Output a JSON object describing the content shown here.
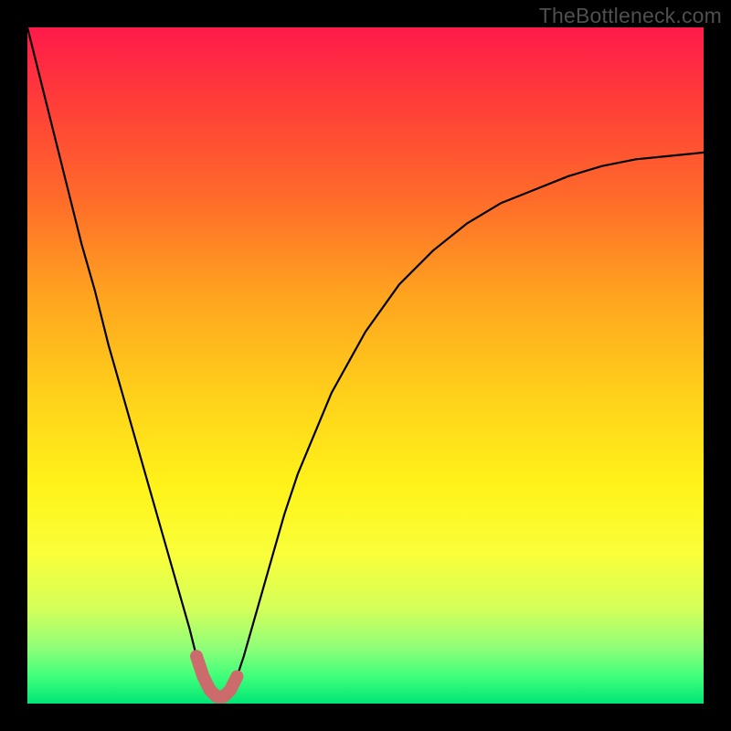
{
  "watermark": "TheBottleneck.com",
  "chart_data": {
    "type": "line",
    "title": "",
    "xlabel": "",
    "ylabel": "",
    "xlim": [
      0,
      100
    ],
    "ylim": [
      0,
      100
    ],
    "grid": false,
    "legend": null,
    "series": [
      {
        "name": "bottleneck-curve",
        "color": "#000000",
        "x": [
          0,
          2,
          4,
          6,
          8,
          10,
          12,
          14,
          16,
          18,
          20,
          22,
          24,
          25,
          26,
          27,
          28,
          29,
          30,
          31,
          32,
          34,
          36,
          38,
          40,
          45,
          50,
          55,
          60,
          65,
          70,
          75,
          80,
          85,
          90,
          95,
          100
        ],
        "y": [
          100,
          92,
          84,
          76,
          68,
          61,
          53,
          46,
          39,
          32,
          25,
          18,
          11,
          7,
          4,
          2,
          1,
          1,
          2,
          4,
          7,
          14,
          21,
          28,
          34,
          46,
          55,
          62,
          67,
          71,
          74,
          76,
          78,
          79.5,
          80.5,
          81,
          81.5
        ]
      },
      {
        "name": "highlight-segment",
        "color": "#cc6b6b",
        "x": [
          25,
          26,
          27,
          28,
          29,
          30,
          31
        ],
        "y": [
          7,
          4,
          2,
          1,
          1,
          2,
          4
        ]
      }
    ],
    "background_gradient": {
      "stops": [
        {
          "pos": 0.0,
          "color": "#ff1a4b"
        },
        {
          "pos": 0.1,
          "color": "#ff3a3a"
        },
        {
          "pos": 0.25,
          "color": "#ff6a2a"
        },
        {
          "pos": 0.4,
          "color": "#ffa51f"
        },
        {
          "pos": 0.55,
          "color": "#ffd21a"
        },
        {
          "pos": 0.68,
          "color": "#fff31a"
        },
        {
          "pos": 0.78,
          "color": "#f9ff3a"
        },
        {
          "pos": 0.86,
          "color": "#d4ff5a"
        },
        {
          "pos": 0.92,
          "color": "#8cff7a"
        },
        {
          "pos": 0.96,
          "color": "#3fff7a"
        },
        {
          "pos": 1.0,
          "color": "#00e676"
        }
      ]
    }
  }
}
